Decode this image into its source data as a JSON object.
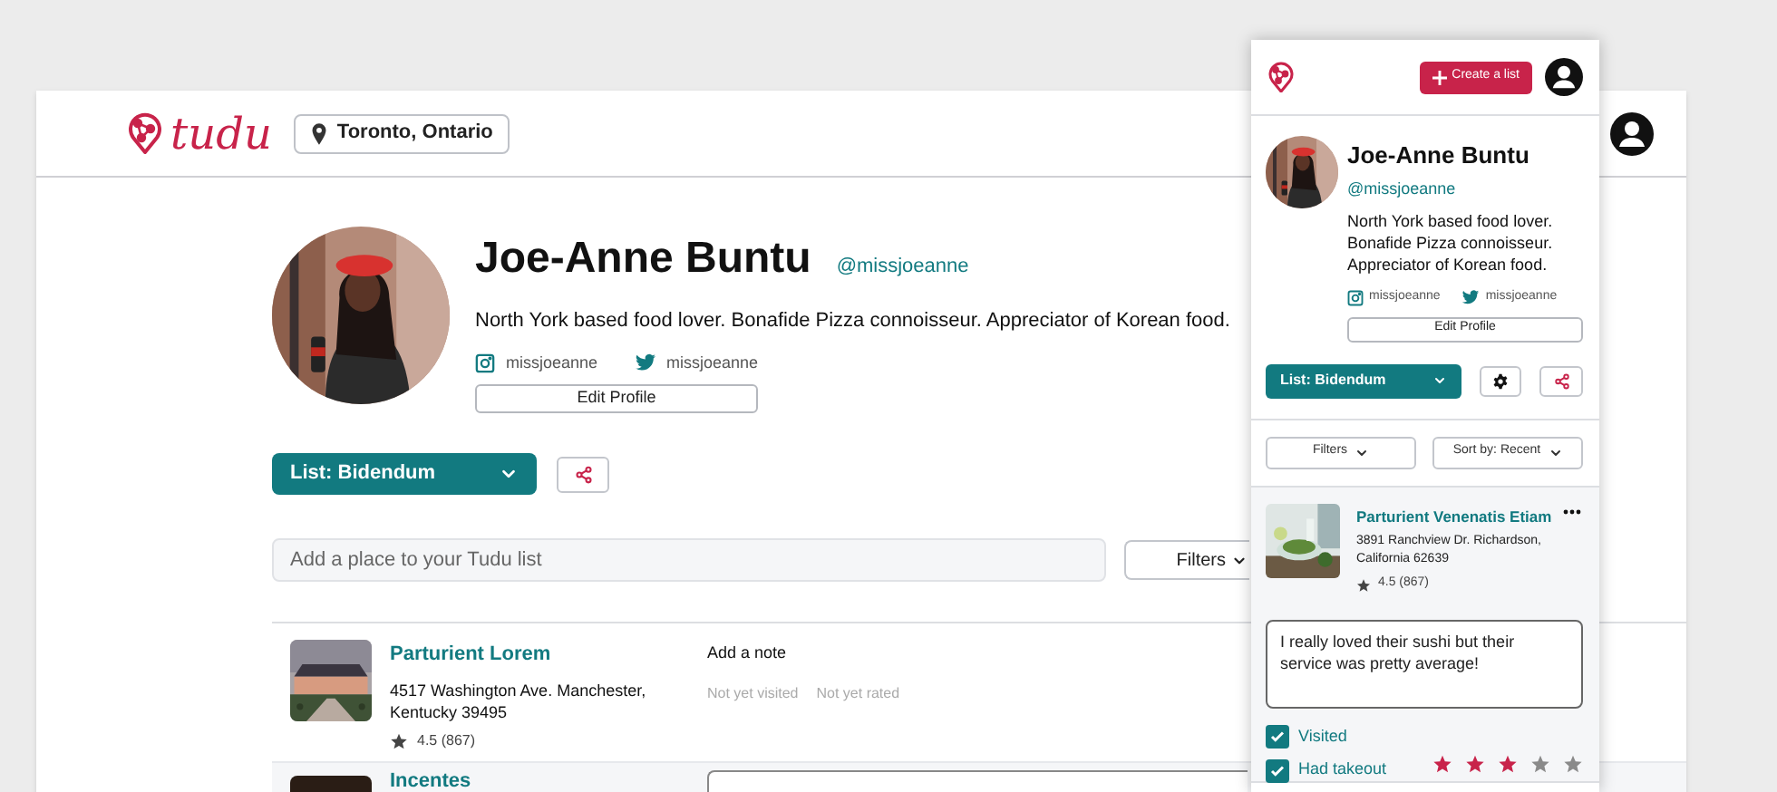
{
  "desktop": {
    "logo": "tudu",
    "location": "Toronto, Ontario",
    "profile": {
      "name": "Joe-Anne Buntu",
      "handle": "@missjoeanne",
      "bio": "North York based food lover. Bonafide Pizza connoisseur. Appreciator of Korean food.",
      "instagram": "missjoeanne",
      "twitter": "missjoeanne",
      "edit_button": "Edit Profile"
    },
    "list_button": "List: Bidendum",
    "search": {
      "placeholder": "Add a place to your Tudu list"
    },
    "filters_button": "Filters",
    "places": [
      {
        "name": "Parturient Lorem",
        "address": "4517 Washington Ave. Manchester, Kentucky 39495",
        "rating": "4.5 (867)",
        "note_prompt": "Add a note",
        "visit_status": "Not yet visited",
        "rate_status": "Not yet rated"
      },
      {
        "name": "Incentes"
      }
    ]
  },
  "mobile": {
    "create_button": "Create a list",
    "profile": {
      "name": "Joe-Anne Buntu",
      "handle": "@missjoeanne",
      "bio": "North York based food lover. Bonafide Pizza connoisseur. Appreciator of Korean food.",
      "instagram": "missjoeanne",
      "twitter": "missjoeanne",
      "edit_button": "Edit Profile"
    },
    "list_button": "List: Bidendum",
    "filters_button": "Filters",
    "sort_button": "Sort by: Recent",
    "place": {
      "name": "Parturient Venenatis Etiam",
      "address": "3891 Ranchview Dr. Richardson, California 62639",
      "rating": "4.5 (867)",
      "note": "I really loved their sushi but their service was pretty average!",
      "checks": [
        {
          "label": "Visited",
          "checked": true
        },
        {
          "label": "Had takeout",
          "checked": true
        }
      ],
      "stars": 3
    }
  }
}
